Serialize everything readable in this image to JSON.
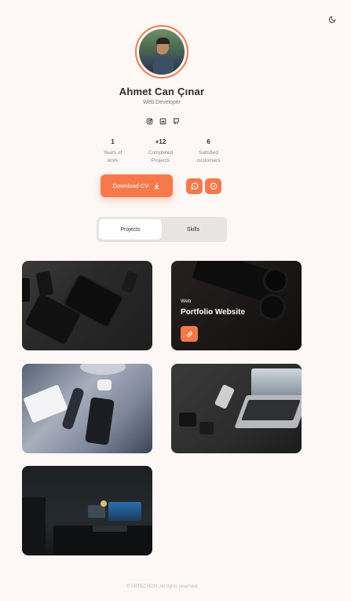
{
  "profile": {
    "name": "Ahmet Can Çınar",
    "role": "Web Developer"
  },
  "social": [
    "instagram-icon",
    "linkedin-icon",
    "github-icon"
  ],
  "stats": [
    {
      "value": "1",
      "label_line1": "Years of",
      "label_line2": "work"
    },
    {
      "value": "+12",
      "label_line1": "Completed",
      "label_line2": "Projects"
    },
    {
      "value": "6",
      "label_line1": "Satisfied",
      "label_line2": "customers"
    }
  ],
  "actions": {
    "download_label": "Download CV"
  },
  "tabs": [
    {
      "label": "Projects",
      "active": true
    },
    {
      "label": "Skills",
      "active": false
    }
  ],
  "projects": [
    {
      "category": "",
      "title": ""
    },
    {
      "category": "Web",
      "title": "Portfolio Website"
    },
    {
      "category": "",
      "title": ""
    },
    {
      "category": "",
      "title": ""
    },
    {
      "category": "",
      "title": ""
    }
  ],
  "footer": {
    "text": "© ARTECHON. All rights reserved"
  },
  "colors": {
    "accent": "#f6794b",
    "background": "#fdf8f6"
  }
}
